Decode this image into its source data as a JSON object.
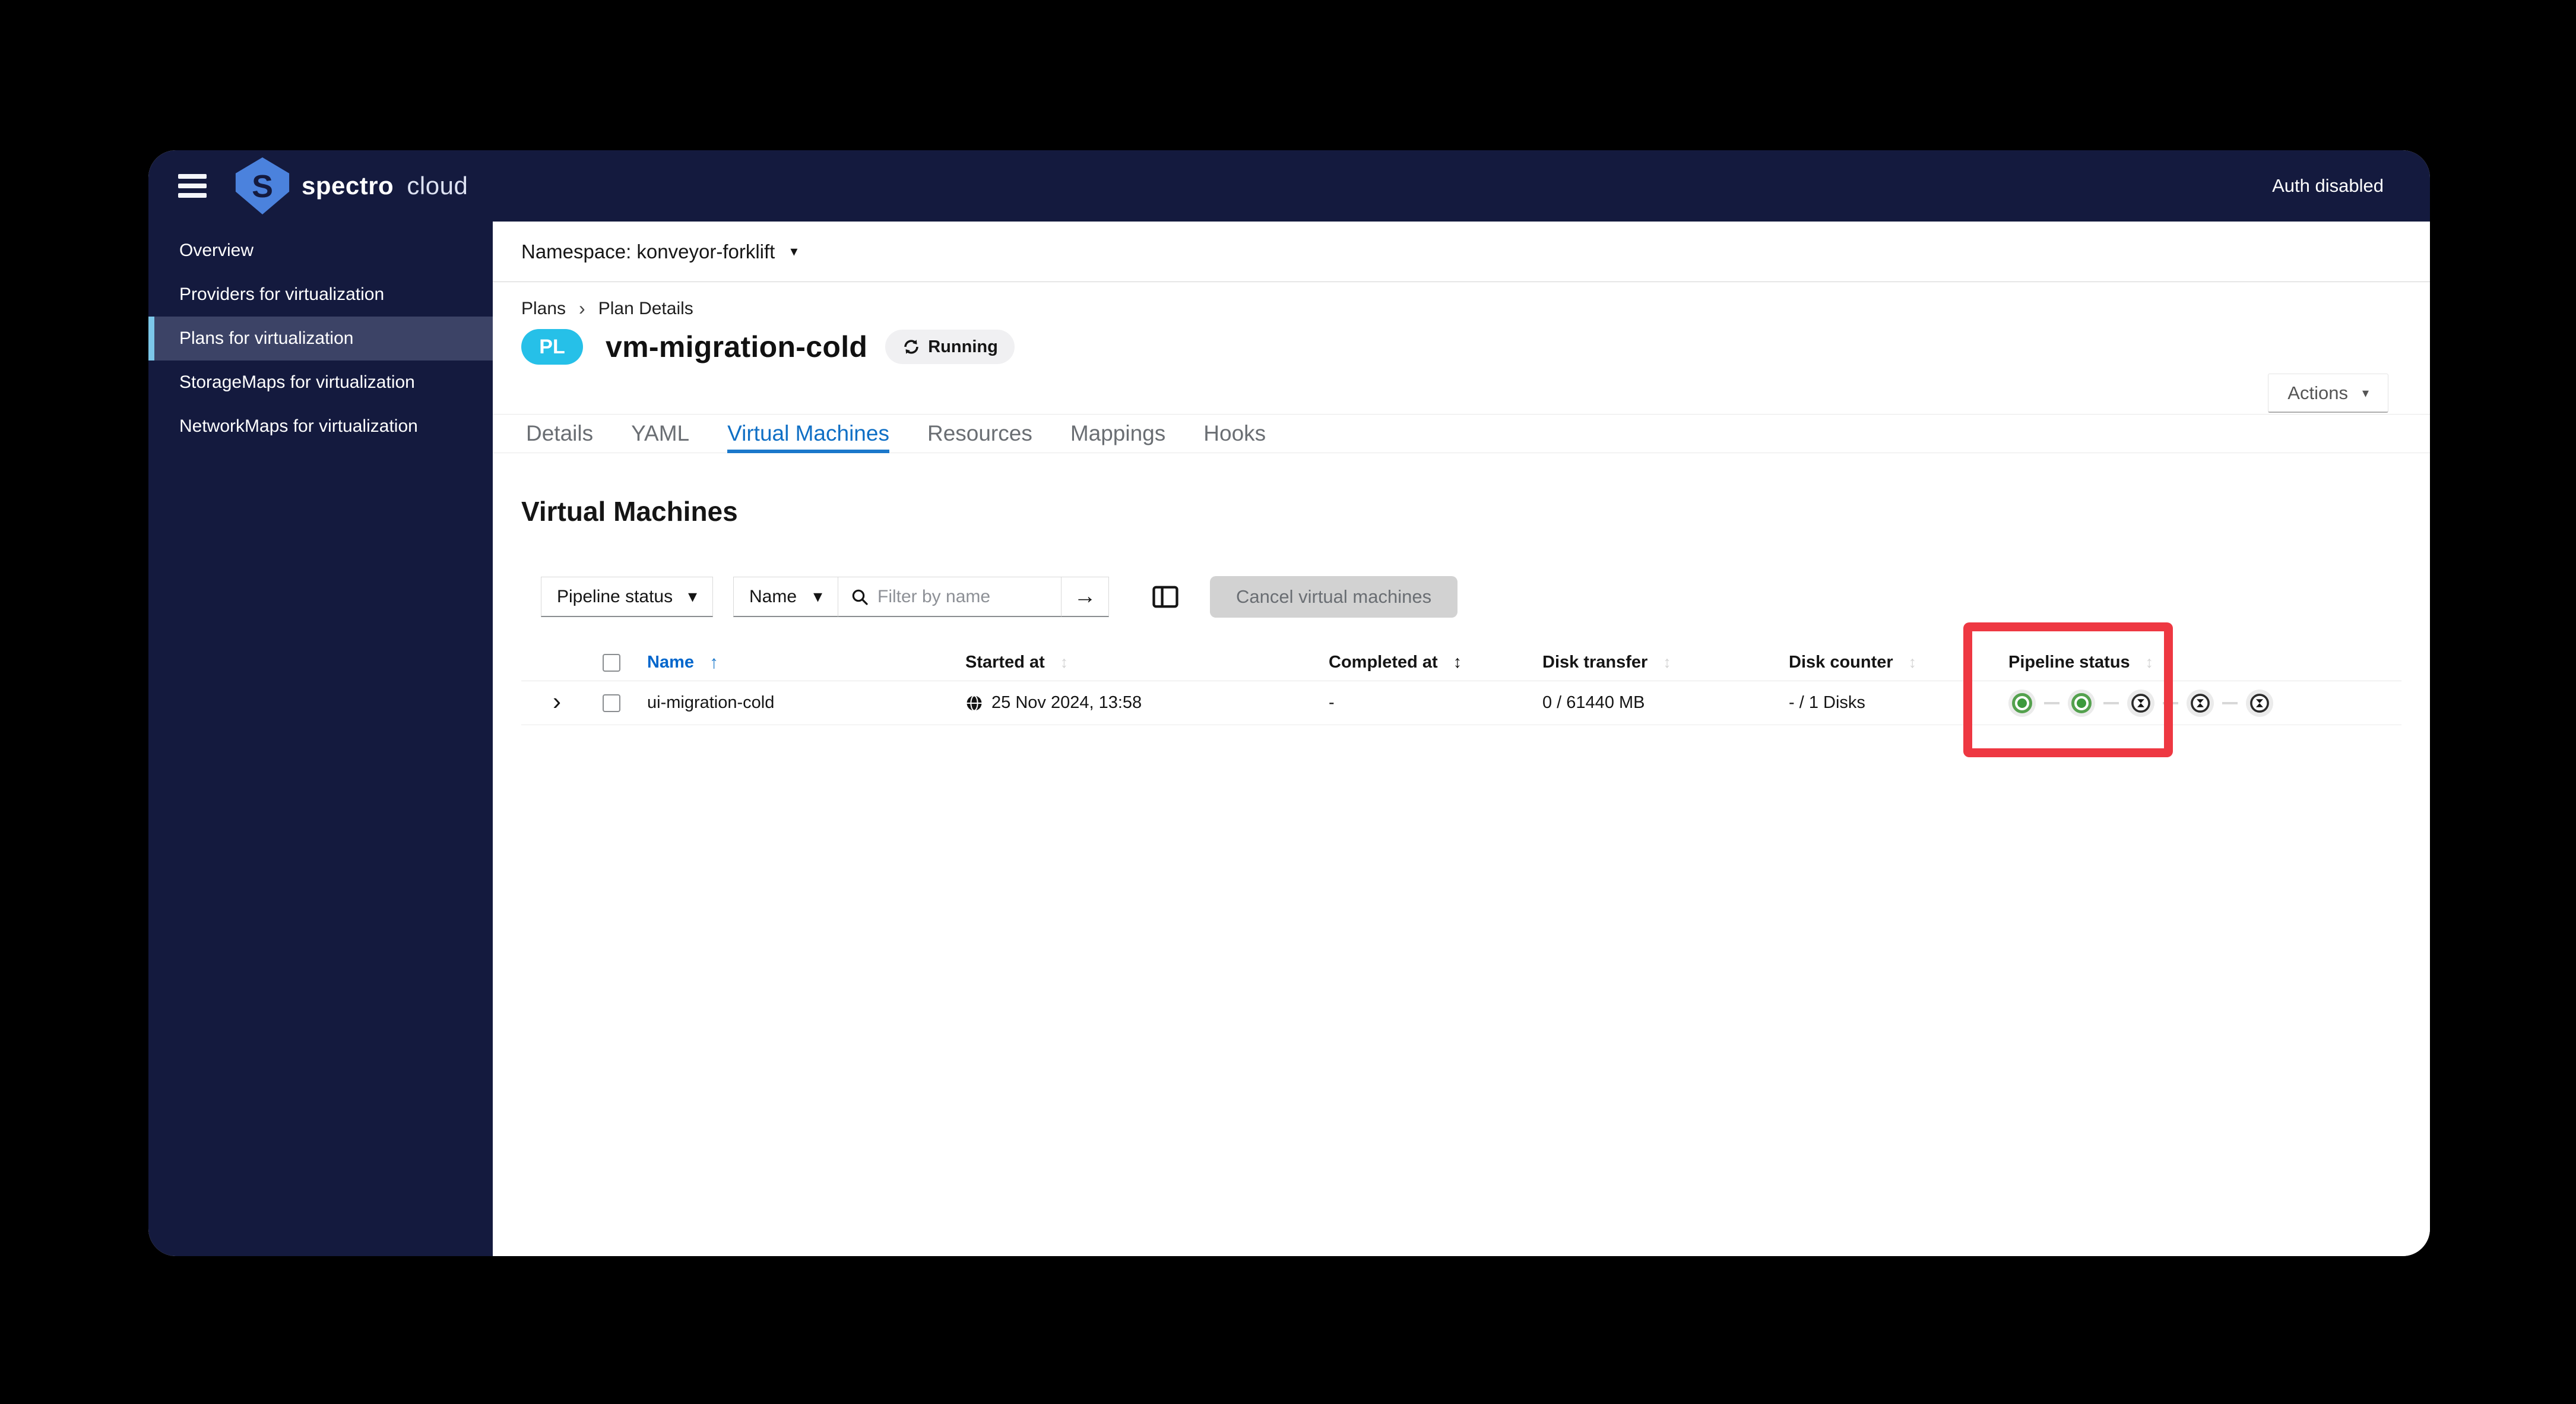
{
  "header": {
    "brand_primary": "spectro",
    "brand_secondary": "cloud",
    "auth_status": "Auth disabled"
  },
  "sidebar": {
    "items": [
      {
        "label": "Overview",
        "active": false
      },
      {
        "label": "Providers for virtualization",
        "active": false
      },
      {
        "label": "Plans for virtualization",
        "active": true
      },
      {
        "label": "StorageMaps for virtualization",
        "active": false
      },
      {
        "label": "NetworkMaps for virtualization",
        "active": false
      }
    ]
  },
  "namespace_bar": {
    "label": "Namespace: konveyor-forklift"
  },
  "breadcrumb": {
    "items": [
      "Plans",
      "Plan Details"
    ]
  },
  "plan": {
    "badge": "PL",
    "title": "vm-migration-cold",
    "status": "Running"
  },
  "actions_button": {
    "label": "Actions"
  },
  "tabs": {
    "items": [
      {
        "label": "Details"
      },
      {
        "label": "YAML"
      },
      {
        "label": "Virtual Machines"
      },
      {
        "label": "Resources"
      },
      {
        "label": "Mappings"
      },
      {
        "label": "Hooks"
      }
    ],
    "active": "Virtual Machines"
  },
  "section": {
    "heading": "Virtual Machines"
  },
  "filters": {
    "pipeline_status_dropdown": "Pipeline status",
    "field_dropdown": "Name",
    "search_placeholder": "Filter by name",
    "submit_arrow": "→",
    "cancel_button_label": "Cancel virtual machines"
  },
  "table": {
    "columns": [
      {
        "label": "Name",
        "sort": "ascending"
      },
      {
        "label": "Started at",
        "sort": "sortable"
      },
      {
        "label": "Completed at",
        "sort": "sortable-highlighted"
      },
      {
        "label": "Disk transfer",
        "sort": "sortable"
      },
      {
        "label": "Disk counter",
        "sort": "sortable"
      },
      {
        "label": "Pipeline status",
        "sort": "sortable"
      }
    ],
    "rows": [
      {
        "name": "ui-migration-cold",
        "started_at": "25 Nov 2024, 13:58",
        "completed_at": "-",
        "disk_transfer": "0 / 61440 MB",
        "disk_counter": "- / 1 Disks",
        "pipeline_stages": [
          "succeeded",
          "succeeded",
          "pending",
          "pending",
          "pending"
        ]
      }
    ]
  },
  "annotation": {
    "type": "highlight-box",
    "target": "Pipeline status column",
    "color": "#ee3842"
  },
  "colors": {
    "topbar_navy": "#141a3e",
    "sidebar_active_bg": "#3c4366",
    "sidebar_accent": "#7cc7e9",
    "badge_cyan": "#26c0e8",
    "link_blue": "#0f6fc5",
    "highlight_red": "#ee3842",
    "stage_green": "#3c9a3c",
    "status_pill_bg": "#f0f0f2"
  }
}
